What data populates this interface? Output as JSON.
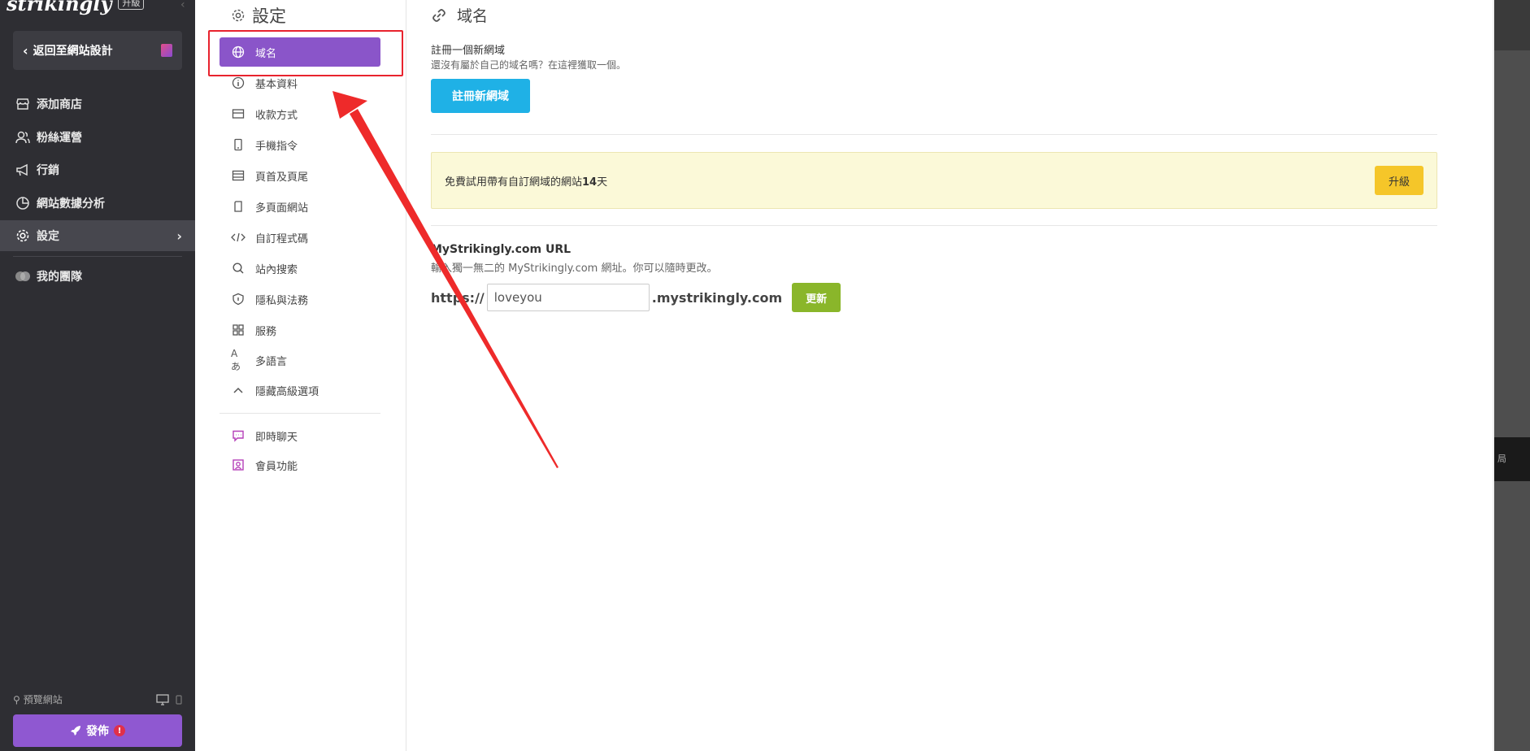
{
  "app": {
    "logo_text": "strikingly",
    "upgrade_tag": "升級",
    "back_button": "返回至網站設計"
  },
  "nav": {
    "items": [
      {
        "label": "添加商店",
        "icon": "store-icon"
      },
      {
        "label": "粉絲運營",
        "icon": "users-icon"
      },
      {
        "label": "行銷",
        "icon": "megaphone-icon"
      },
      {
        "label": "網站數據分析",
        "icon": "pie-chart-icon"
      },
      {
        "label": "設定",
        "icon": "gear-icon",
        "active": true
      },
      {
        "label": "我的團隊",
        "icon": "team-icon"
      }
    ],
    "preview_label": "預覽網站",
    "publish_label": "發佈",
    "publish_alert": "!"
  },
  "settings": {
    "title": "設定",
    "items": [
      {
        "label": "域名",
        "icon": "globe-icon",
        "active": true
      },
      {
        "label": "基本資料",
        "icon": "info-icon"
      },
      {
        "label": "收款方式",
        "icon": "wallet-icon"
      },
      {
        "label": "手機指令",
        "icon": "mobile-icon"
      },
      {
        "label": "頁首及頁尾",
        "icon": "layout-icon"
      },
      {
        "label": "多頁面網站",
        "icon": "pages-icon"
      },
      {
        "label": "自訂程式碼",
        "icon": "code-icon"
      },
      {
        "label": "站內搜索",
        "icon": "search-icon"
      },
      {
        "label": "隱私與法務",
        "icon": "shield-icon"
      },
      {
        "label": "服務",
        "icon": "grid-icon"
      },
      {
        "label": "多語言",
        "icon": "language-icon"
      },
      {
        "label": "隱藏高級選項",
        "icon": "chevron-up-icon"
      },
      {
        "label": "即時聊天",
        "icon": "chat-icon"
      },
      {
        "label": "會員功能",
        "icon": "member-icon"
      }
    ]
  },
  "main": {
    "title": "域名",
    "register_title": "註冊一個新網域",
    "register_sub": "還沒有屬於自己的域名嗎？在這裡獲取一個。",
    "register_button": "註冊新網域",
    "trial_text_prefix": "免費試用帶有自訂網域的網站",
    "trial_days": "14",
    "trial_text_suffix": "天",
    "trial_upgrade_button": "升級",
    "url_title": "MyStrikingly.com URL",
    "url_sub": "輸入獨一無二的 MyStrikingly.com 網址。你可以隨時更改。",
    "url_prefix": "https://",
    "url_value": "loveyou",
    "url_suffix": ".mystrikingly.com",
    "update_button": "更新"
  },
  "right_strip": {
    "label": "局"
  },
  "colors": {
    "sidebar_bg": "#2e2e33",
    "accent_purple": "#8a55c9",
    "register_blue": "#1fb1e6",
    "update_green": "#8ab62a",
    "trial_yellow": "#f5c629",
    "annotation_red": "#e8232e"
  }
}
